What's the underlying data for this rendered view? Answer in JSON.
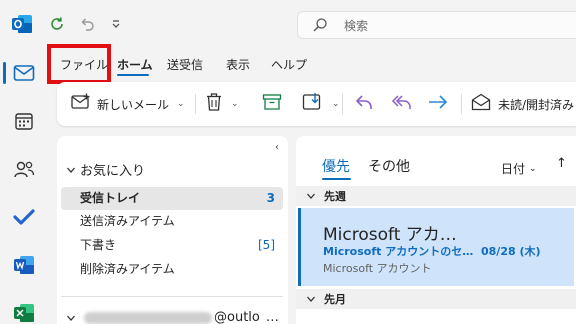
{
  "search": {
    "placeholder": "検索"
  },
  "menu_tabs": [
    "ファイル",
    "ホーム",
    "送受信",
    "表示",
    "ヘルプ"
  ],
  "ribbon": {
    "new_mail_label": "新しいメール",
    "read_unread_label": "未読/開封済み"
  },
  "folders": {
    "favorites_label": "お気に入り",
    "items": [
      {
        "label": "受信トレイ",
        "count": "3"
      },
      {
        "label": "送信済みアイテム",
        "count": ""
      },
      {
        "label": "下書き",
        "count": "[5]"
      },
      {
        "label": "削除済みアイテム",
        "count": ""
      }
    ],
    "account_domain": "@outlo",
    "account_more": "…"
  },
  "messages": {
    "tab_focused": "優先",
    "tab_other": "その他",
    "sort_label": "日付",
    "group_last_week": "先週",
    "group_last_month": "先月",
    "items": [
      {
        "sender": "Microsoft アカ…",
        "subject": "Microsoft アカウントのセ…",
        "date": "08/28 (木)",
        "preview": "Microsoft アカウント"
      }
    ]
  },
  "colors": {
    "accent": "#0f6cbd",
    "highlight_box": "#e10e12",
    "selected_message": "#cfe4fa"
  },
  "icons": [
    "outlook-logo-icon",
    "refresh-icon",
    "undo-icon",
    "customize-chevron-icon",
    "search-icon",
    "mail-icon",
    "calendar-icon",
    "people-icon",
    "todo-icon",
    "word-icon",
    "excel-icon",
    "new-mail-icon",
    "delete-icon",
    "archive-icon",
    "move-icon",
    "reply-icon",
    "reply-all-icon",
    "forward-icon",
    "read-unread-icon"
  ]
}
